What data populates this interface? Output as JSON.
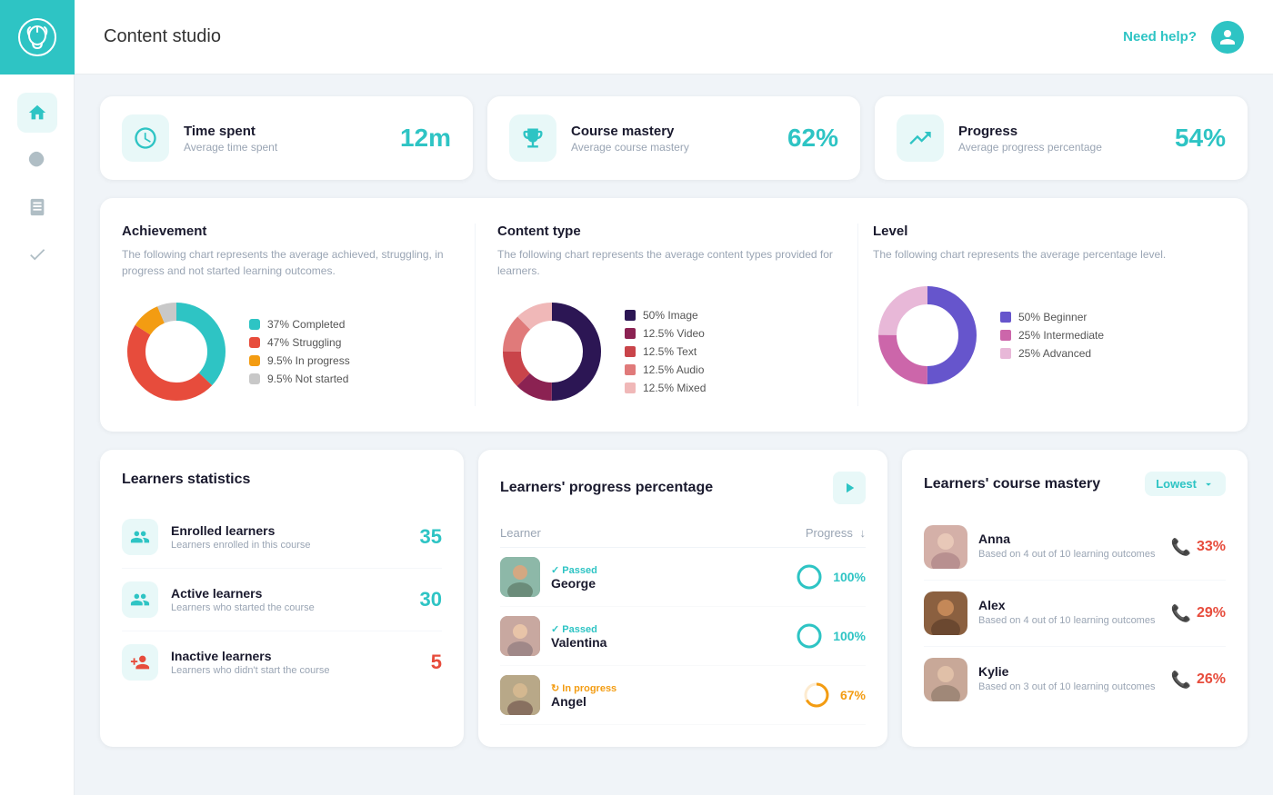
{
  "app": {
    "title": "Content studio",
    "need_help": "Need help?"
  },
  "sidebar": {
    "items": [
      {
        "id": "home",
        "icon": "home"
      },
      {
        "id": "chart",
        "icon": "chart"
      },
      {
        "id": "book",
        "icon": "book"
      },
      {
        "id": "check",
        "icon": "check"
      }
    ]
  },
  "stats": [
    {
      "id": "time-spent",
      "label": "Time spent",
      "sublabel": "Average time spent",
      "value": "12m",
      "icon": "clock"
    },
    {
      "id": "course-mastery",
      "label": "Course mastery",
      "sublabel": "Average course mastery",
      "value": "62%",
      "icon": "trophy"
    },
    {
      "id": "progress",
      "label": "Progress",
      "sublabel": "Average progress percentage",
      "value": "54%",
      "icon": "trending"
    }
  ],
  "charts": {
    "achievement": {
      "title": "Achievement",
      "desc": "The following chart represents the average achieved, struggling, in progress and not started learning outcomes.",
      "legend": [
        {
          "label": "37% Completed",
          "color": "#2ec4c4"
        },
        {
          "label": "47% Struggling",
          "color": "#e74c3c"
        },
        {
          "label": "9.5% In progress",
          "color": "#f39c12"
        },
        {
          "label": "9.5% Not started",
          "color": "#c8c8c8"
        }
      ]
    },
    "content_type": {
      "title": "Content type",
      "desc": "The following chart represents the average content types provided for learners.",
      "legend": [
        {
          "label": "50% Image",
          "color": "#2c1654"
        },
        {
          "label": "12.5% Video",
          "color": "#8b2252"
        },
        {
          "label": "12.5% Text",
          "color": "#c9444a"
        },
        {
          "label": "12.5% Audio",
          "color": "#e07a7a"
        },
        {
          "label": "12.5% Mixed",
          "color": "#f0b8b8"
        }
      ]
    },
    "level": {
      "title": "Level",
      "desc": "The following chart represents the average percentage level.",
      "legend": [
        {
          "label": "50% Beginner",
          "color": "#6655cc"
        },
        {
          "label": "25% Intermediate",
          "color": "#cc66aa"
        },
        {
          "label": "25% Advanced",
          "color": "#e8b8d8"
        }
      ]
    }
  },
  "learner_stats": {
    "title": "Learners statistics",
    "rows": [
      {
        "label": "Enrolled learners",
        "sub": "Learners enrolled in this course",
        "value": "35",
        "color": "teal",
        "icon": "users"
      },
      {
        "label": "Active learners",
        "sub": "Learners who started the course",
        "value": "30",
        "color": "teal",
        "icon": "users-active"
      },
      {
        "label": "Inactive learners",
        "sub": "Learners who didn't start the course",
        "value": "5",
        "color": "red",
        "icon": "users-inactive"
      }
    ]
  },
  "progress_table": {
    "title": "Learners' progress percentage",
    "col_learner": "Learner",
    "col_progress": "Progress",
    "rows": [
      {
        "name": "George",
        "status": "Passed",
        "status_type": "passed",
        "progress": "100%",
        "bg": "#a0d8d8"
      },
      {
        "name": "Valentina",
        "status": "Passed",
        "status_type": "passed",
        "progress": "100%",
        "bg": "#c8aaaa"
      },
      {
        "name": "Angel",
        "status": "In progress",
        "status_type": "inprogress",
        "progress": "67%",
        "bg": "#b8b0a0"
      }
    ]
  },
  "course_mastery": {
    "title": "Learners' course mastery",
    "filter_label": "Lowest",
    "rows": [
      {
        "name": "Anna",
        "sub": "Based on 4 out of 10 learning outcomes",
        "value": "33%",
        "bg": "#c89090"
      },
      {
        "name": "Alex",
        "sub": "Based on 4 out of 10 learning outcomes",
        "value": "29%",
        "bg": "#9e6848"
      },
      {
        "name": "Kylie",
        "sub": "Based on 3 out of 10 learning outcomes",
        "value": "26%",
        "bg": "#c8a898"
      }
    ]
  }
}
